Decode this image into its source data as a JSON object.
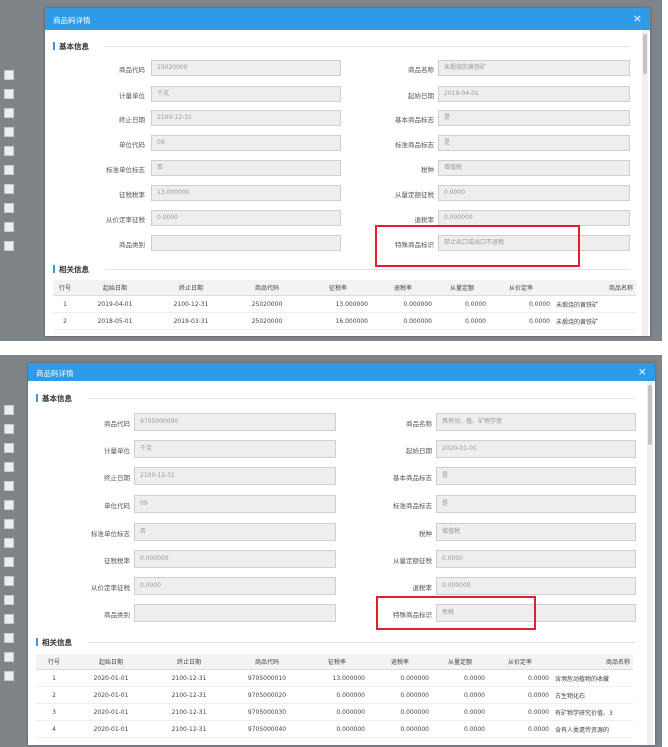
{
  "dialog1": {
    "title": "商品码详情",
    "close": "×",
    "basic_title": "基本信息",
    "related_title": "相关信息",
    "fields": [
      {
        "label": "商品代码",
        "value": "25020000"
      },
      {
        "label": "商品名称",
        "value": "未煅烧的黄铁矿"
      },
      {
        "label": "计量单位",
        "value": "千克"
      },
      {
        "label": "起始日期",
        "value": "2019-04-01"
      },
      {
        "label": "终止日期",
        "value": "2100-12-31"
      },
      {
        "label": "基本商品标志",
        "value": "是"
      },
      {
        "label": "单位代码",
        "value": "09"
      },
      {
        "label": "标准商品标志",
        "value": "是"
      },
      {
        "label": "标准单位标志",
        "value": "否"
      },
      {
        "label": "税种",
        "value": "增值税"
      },
      {
        "label": "征税税率",
        "value": "13.000000"
      },
      {
        "label": "从量定额征税",
        "value": "0.0000"
      },
      {
        "label": "从价定率征税",
        "value": "0.0000"
      },
      {
        "label": "退税率",
        "value": "0.000000"
      },
      {
        "label": "商品类别",
        "value": ""
      },
      {
        "label": "特殊商品标识",
        "value": "禁止出口或出口不退税"
      }
    ],
    "columns": [
      "行号",
      "起始日期",
      "终止日期",
      "商品代码",
      "征税率",
      "退税率",
      "从量定额",
      "从价定率",
      "商品名称"
    ],
    "rows": [
      [
        "1",
        "2019-04-01",
        "2100-12-31",
        "25020000",
        "13.000000",
        "0.000000",
        "0.0000",
        "0.0000",
        "未煅烧的黄铁矿"
      ],
      [
        "2",
        "2018-05-01",
        "2019-03-31",
        "25020000",
        "16.000000",
        "0.000000",
        "0.0000",
        "0.0000",
        "未煅烧的黄铁矿"
      ]
    ]
  },
  "dialog2": {
    "title": "商品码详情",
    "close": "×",
    "basic_title": "基本信息",
    "related_title": "相关信息",
    "fields": [
      {
        "label": "商品代码",
        "value": "9705000090"
      },
      {
        "label": "商品名称",
        "value": "具有动、植、矿物学意"
      },
      {
        "label": "计量单位",
        "value": "千克"
      },
      {
        "label": "起始日期",
        "value": "2020-01-01"
      },
      {
        "label": "终止日期",
        "value": "2100-12-31"
      },
      {
        "label": "基本商品标志",
        "value": "是"
      },
      {
        "label": "单位代码",
        "value": "09"
      },
      {
        "label": "标准商品标志",
        "value": "是"
      },
      {
        "label": "标准单位标志",
        "value": "否"
      },
      {
        "label": "税种",
        "value": "增值税"
      },
      {
        "label": "征税税率",
        "value": "0.000000"
      },
      {
        "label": "从量定额征税",
        "value": "0.0000"
      },
      {
        "label": "从价定率征税",
        "value": "0.0000"
      },
      {
        "label": "退税率",
        "value": "0.000000"
      },
      {
        "label": "商品类别",
        "value": ""
      },
      {
        "label": "特殊商品标识",
        "value": "免税"
      }
    ],
    "columns": [
      "行号",
      "起始日期",
      "终止日期",
      "商品代码",
      "征税率",
      "退税率",
      "从量定额",
      "从价定率",
      "商品名称"
    ],
    "rows": [
      [
        "1",
        "2020-01-01",
        "2100-12-31",
        "9705000010",
        "13.000000",
        "0.000000",
        "0.0000",
        "0.0000",
        "含濒危动植物的收藏"
      ],
      [
        "2",
        "2020-01-01",
        "2100-12-31",
        "9705000020",
        "0.000000",
        "0.000000",
        "0.0000",
        "0.0000",
        "古生物化石"
      ],
      [
        "3",
        "2020-01-01",
        "2100-12-31",
        "9705000030",
        "0.000000",
        "0.000000",
        "0.0000",
        "0.0000",
        "有矿物学研究价值、3"
      ],
      [
        "4",
        "2020-01-01",
        "2100-12-31",
        "9705000040",
        "0.000000",
        "0.000000",
        "0.0000",
        "0.0000",
        "含有人类遗传资源的"
      ]
    ]
  },
  "colors": {
    "accent": "#2e9be8",
    "highlight": "#e0202a"
  }
}
